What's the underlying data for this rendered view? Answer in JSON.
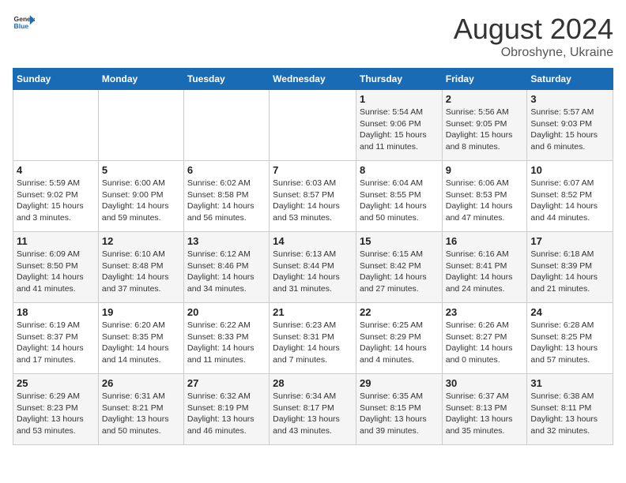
{
  "header": {
    "logo_line1": "General",
    "logo_line2": "Blue",
    "month": "August 2024",
    "location": "Obroshyne, Ukraine"
  },
  "weekdays": [
    "Sunday",
    "Monday",
    "Tuesday",
    "Wednesday",
    "Thursday",
    "Friday",
    "Saturday"
  ],
  "weeks": [
    [
      {
        "day": "",
        "info": ""
      },
      {
        "day": "",
        "info": ""
      },
      {
        "day": "",
        "info": ""
      },
      {
        "day": "",
        "info": ""
      },
      {
        "day": "1",
        "info": "Sunrise: 5:54 AM\nSunset: 9:06 PM\nDaylight: 15 hours\nand 11 minutes."
      },
      {
        "day": "2",
        "info": "Sunrise: 5:56 AM\nSunset: 9:05 PM\nDaylight: 15 hours\nand 8 minutes."
      },
      {
        "day": "3",
        "info": "Sunrise: 5:57 AM\nSunset: 9:03 PM\nDaylight: 15 hours\nand 6 minutes."
      }
    ],
    [
      {
        "day": "4",
        "info": "Sunrise: 5:59 AM\nSunset: 9:02 PM\nDaylight: 15 hours\nand 3 minutes."
      },
      {
        "day": "5",
        "info": "Sunrise: 6:00 AM\nSunset: 9:00 PM\nDaylight: 14 hours\nand 59 minutes."
      },
      {
        "day": "6",
        "info": "Sunrise: 6:02 AM\nSunset: 8:58 PM\nDaylight: 14 hours\nand 56 minutes."
      },
      {
        "day": "7",
        "info": "Sunrise: 6:03 AM\nSunset: 8:57 PM\nDaylight: 14 hours\nand 53 minutes."
      },
      {
        "day": "8",
        "info": "Sunrise: 6:04 AM\nSunset: 8:55 PM\nDaylight: 14 hours\nand 50 minutes."
      },
      {
        "day": "9",
        "info": "Sunrise: 6:06 AM\nSunset: 8:53 PM\nDaylight: 14 hours\nand 47 minutes."
      },
      {
        "day": "10",
        "info": "Sunrise: 6:07 AM\nSunset: 8:52 PM\nDaylight: 14 hours\nand 44 minutes."
      }
    ],
    [
      {
        "day": "11",
        "info": "Sunrise: 6:09 AM\nSunset: 8:50 PM\nDaylight: 14 hours\nand 41 minutes."
      },
      {
        "day": "12",
        "info": "Sunrise: 6:10 AM\nSunset: 8:48 PM\nDaylight: 14 hours\nand 37 minutes."
      },
      {
        "day": "13",
        "info": "Sunrise: 6:12 AM\nSunset: 8:46 PM\nDaylight: 14 hours\nand 34 minutes."
      },
      {
        "day": "14",
        "info": "Sunrise: 6:13 AM\nSunset: 8:44 PM\nDaylight: 14 hours\nand 31 minutes."
      },
      {
        "day": "15",
        "info": "Sunrise: 6:15 AM\nSunset: 8:42 PM\nDaylight: 14 hours\nand 27 minutes."
      },
      {
        "day": "16",
        "info": "Sunrise: 6:16 AM\nSunset: 8:41 PM\nDaylight: 14 hours\nand 24 minutes."
      },
      {
        "day": "17",
        "info": "Sunrise: 6:18 AM\nSunset: 8:39 PM\nDaylight: 14 hours\nand 21 minutes."
      }
    ],
    [
      {
        "day": "18",
        "info": "Sunrise: 6:19 AM\nSunset: 8:37 PM\nDaylight: 14 hours\nand 17 minutes."
      },
      {
        "day": "19",
        "info": "Sunrise: 6:20 AM\nSunset: 8:35 PM\nDaylight: 14 hours\nand 14 minutes."
      },
      {
        "day": "20",
        "info": "Sunrise: 6:22 AM\nSunset: 8:33 PM\nDaylight: 14 hours\nand 11 minutes."
      },
      {
        "day": "21",
        "info": "Sunrise: 6:23 AM\nSunset: 8:31 PM\nDaylight: 14 hours\nand 7 minutes."
      },
      {
        "day": "22",
        "info": "Sunrise: 6:25 AM\nSunset: 8:29 PM\nDaylight: 14 hours\nand 4 minutes."
      },
      {
        "day": "23",
        "info": "Sunrise: 6:26 AM\nSunset: 8:27 PM\nDaylight: 14 hours\nand 0 minutes."
      },
      {
        "day": "24",
        "info": "Sunrise: 6:28 AM\nSunset: 8:25 PM\nDaylight: 13 hours\nand 57 minutes."
      }
    ],
    [
      {
        "day": "25",
        "info": "Sunrise: 6:29 AM\nSunset: 8:23 PM\nDaylight: 13 hours\nand 53 minutes."
      },
      {
        "day": "26",
        "info": "Sunrise: 6:31 AM\nSunset: 8:21 PM\nDaylight: 13 hours\nand 50 minutes."
      },
      {
        "day": "27",
        "info": "Sunrise: 6:32 AM\nSunset: 8:19 PM\nDaylight: 13 hours\nand 46 minutes."
      },
      {
        "day": "28",
        "info": "Sunrise: 6:34 AM\nSunset: 8:17 PM\nDaylight: 13 hours\nand 43 minutes."
      },
      {
        "day": "29",
        "info": "Sunrise: 6:35 AM\nSunset: 8:15 PM\nDaylight: 13 hours\nand 39 minutes."
      },
      {
        "day": "30",
        "info": "Sunrise: 6:37 AM\nSunset: 8:13 PM\nDaylight: 13 hours\nand 35 minutes."
      },
      {
        "day": "31",
        "info": "Sunrise: 6:38 AM\nSunset: 8:11 PM\nDaylight: 13 hours\nand 32 minutes."
      }
    ]
  ]
}
